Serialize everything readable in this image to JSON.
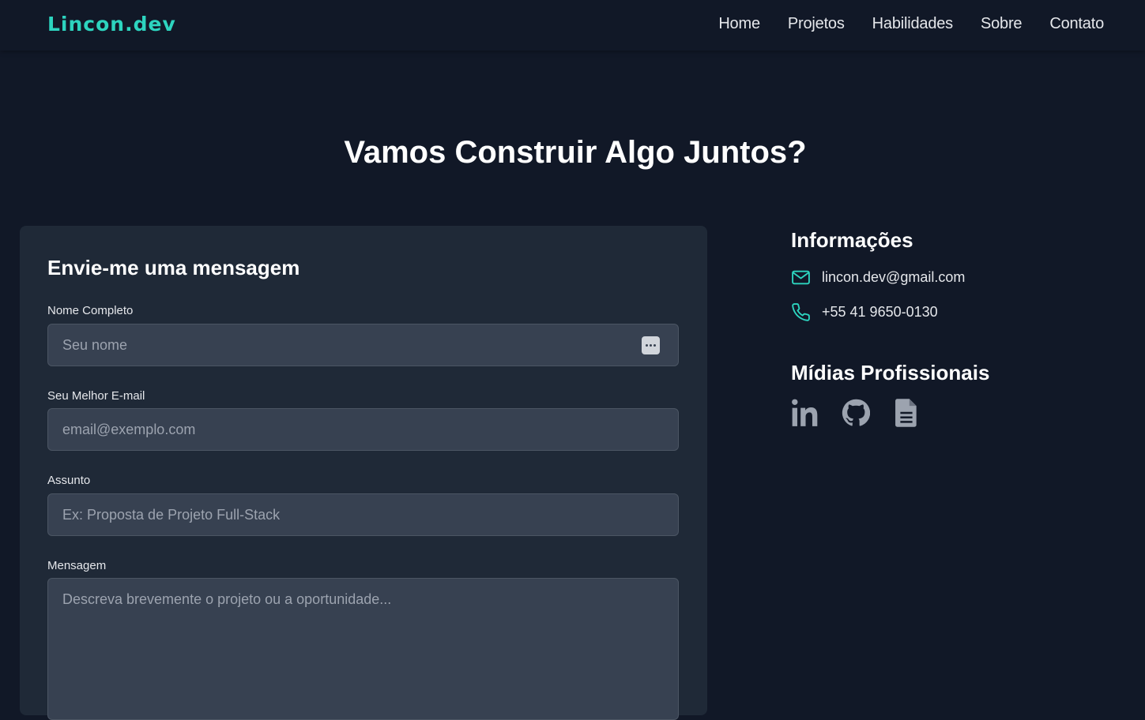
{
  "nav": {
    "logo": "Lincon.dev",
    "links": [
      "Home",
      "Projetos",
      "Habilidades",
      "Sobre",
      "Contato"
    ]
  },
  "section": {
    "title": "Vamos Construir Algo Juntos?"
  },
  "form": {
    "heading": "Envie-me uma mensagem",
    "name": {
      "label": "Nome Completo",
      "placeholder": "Seu nome"
    },
    "email": {
      "label": "Seu Melhor E-mail",
      "placeholder": "email@exemplo.com"
    },
    "subject": {
      "label": "Assunto",
      "placeholder": "Ex: Proposta de Projeto Full-Stack"
    },
    "message": {
      "label": "Mensagem",
      "placeholder": "Descreva brevemente o projeto ou a oportunidade..."
    }
  },
  "info": {
    "heading": "Informações",
    "email": "lincon.dev@gmail.com",
    "phone": "+55 41 9650-0130"
  },
  "social": {
    "heading": "Mídias Profissionais",
    "icons": [
      "linkedin-icon",
      "github-icon",
      "document-icon"
    ]
  },
  "colors": {
    "accent": "#2dd4bf",
    "background": "#111827",
    "card": "#1f2937",
    "input": "#374151",
    "icon_muted": "#9ca3af"
  }
}
